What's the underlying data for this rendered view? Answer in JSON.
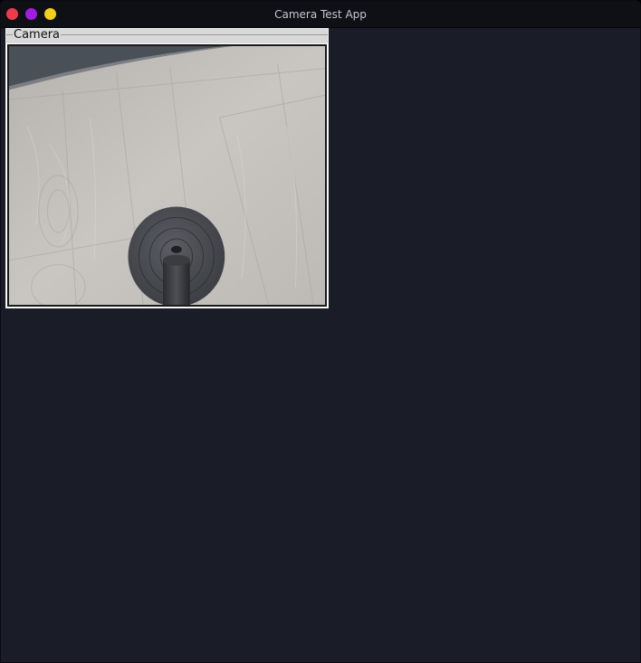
{
  "window": {
    "title": "Camera Test App"
  },
  "colors": {
    "close": "#ee3b4c",
    "minimize": "#a01ee0",
    "maximize": "#f2cf1a",
    "background": "#1a1d27",
    "titlebar": "#0e1016"
  },
  "camera": {
    "group_label": "Camera"
  }
}
